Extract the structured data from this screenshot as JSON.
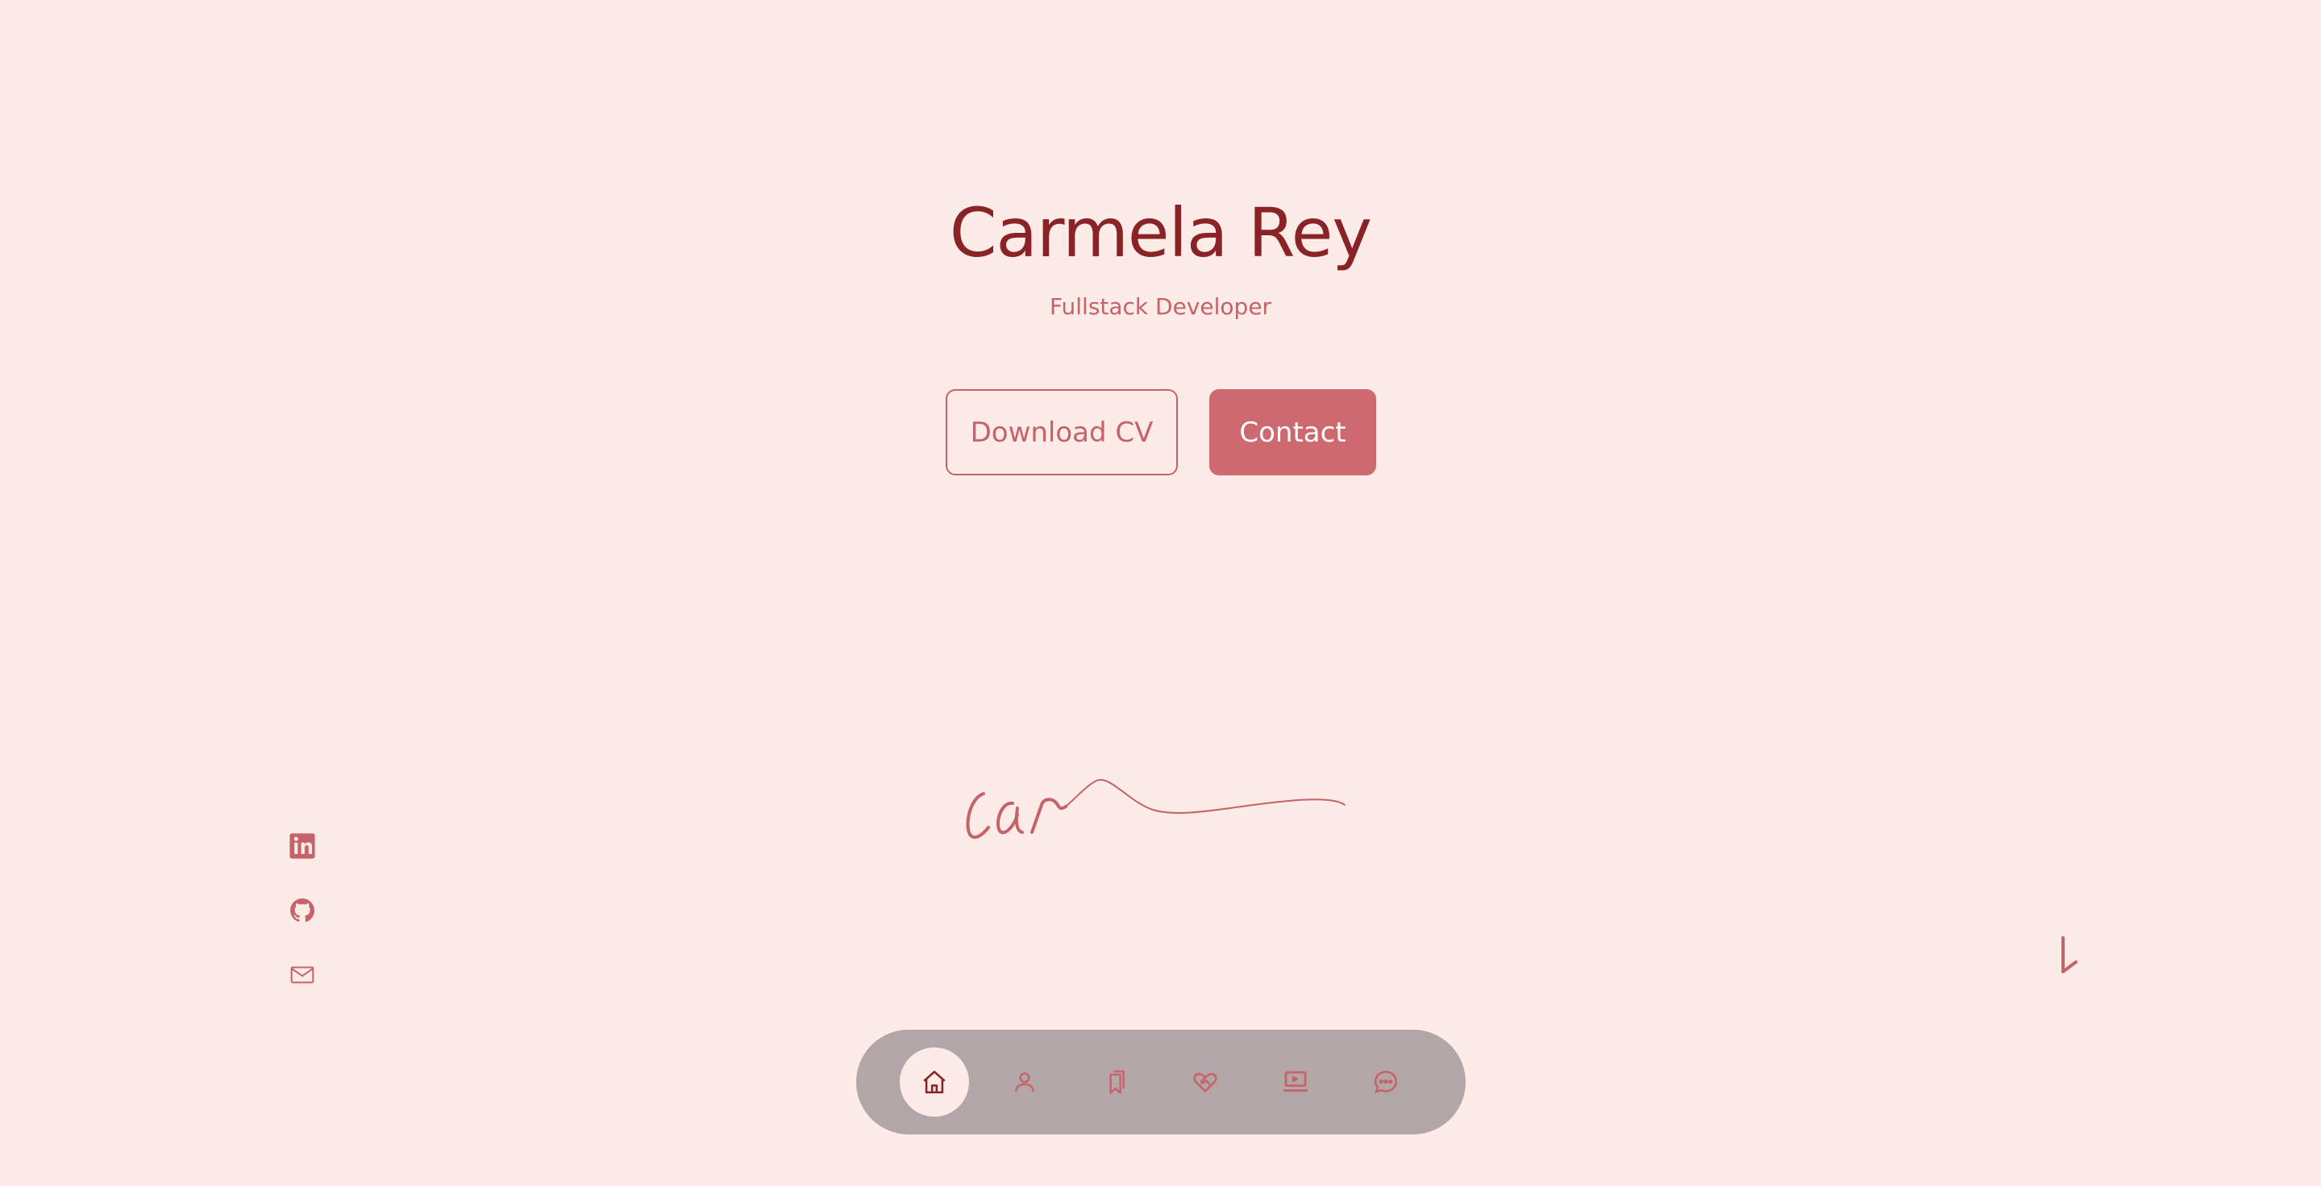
{
  "hero": {
    "name": "Carmela Rey",
    "role": "Fullstack Developer"
  },
  "buttons": {
    "download_cv": "Download CV",
    "contact": "Contact"
  },
  "signature": {
    "text": "car"
  },
  "socials": [
    {
      "icon": "linkedin-icon"
    },
    {
      "icon": "github-icon"
    },
    {
      "icon": "mail-icon"
    }
  ],
  "dock": {
    "items": [
      {
        "icon": "home-icon",
        "active": true
      },
      {
        "icon": "user-icon",
        "active": false
      },
      {
        "icon": "bookmarks-icon",
        "active": false
      },
      {
        "icon": "heart-handshake-icon",
        "active": false
      },
      {
        "icon": "laptop-icon",
        "active": false
      },
      {
        "icon": "chat-bubble-icon",
        "active": false
      }
    ]
  },
  "colors": {
    "background": "#fdebe7",
    "title": "#8a2328",
    "accent": "#cd6a6f",
    "dock": "#b3a6a6"
  }
}
